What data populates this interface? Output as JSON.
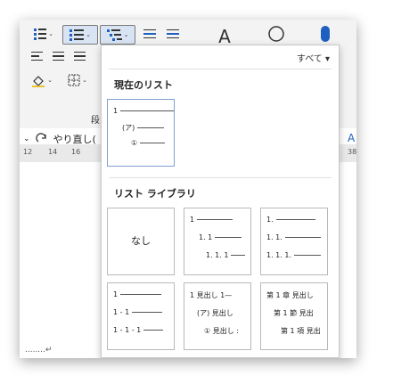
{
  "ribbon": {
    "paragraph_group_label": "段",
    "undo_label": "やり直し(",
    "font_style_icon": "A"
  },
  "ruler": {
    "ticks": [
      "12",
      "14",
      "16",
      "38"
    ]
  },
  "dropdown": {
    "filter_label": "すべて ▾",
    "current_list_title": "現在のリスト",
    "library_title": "リスト ライブラリ",
    "current_list": [
      {
        "label": "1",
        "indent": 0,
        "line": 60
      },
      {
        "label": "(ア)",
        "indent": 10,
        "line": 30
      },
      {
        "label": "①",
        "indent": 20,
        "line": 28
      }
    ],
    "library": [
      {
        "type": "none",
        "label": "なし"
      },
      {
        "type": "rows",
        "rows": [
          {
            "label": "1",
            "indent": 0,
            "line": 40
          },
          {
            "label": "1. 1",
            "indent": 10,
            "line": 30
          },
          {
            "label": "1. 1. 1",
            "indent": 18,
            "line": 16
          }
        ]
      },
      {
        "type": "rows",
        "rows": [
          {
            "label": "1.",
            "indent": 0,
            "line": 44
          },
          {
            "label": "1. 1.",
            "indent": 0,
            "line": 40
          },
          {
            "label": "1. 1. 1.",
            "indent": 0,
            "line": 30
          }
        ]
      },
      {
        "type": "rows",
        "rows": [
          {
            "label": "1",
            "indent": 0,
            "line": 46
          },
          {
            "label": "1 - 1",
            "indent": 0,
            "line": 34
          },
          {
            "label": "1 - 1 - 1",
            "indent": 0,
            "line": 22
          }
        ]
      },
      {
        "type": "rows",
        "rows": [
          {
            "label": "1 見出し 1—",
            "indent": 0,
            "line": 0
          },
          {
            "label": "(ア) 見出し",
            "indent": 8,
            "line": 0
          },
          {
            "label": "① 見出し :",
            "indent": 16,
            "line": 0
          }
        ]
      },
      {
        "type": "rows",
        "rows": [
          {
            "label": "第 1 章 見出し",
            "indent": 0,
            "line": 0
          },
          {
            "label": "第 1 節 見出",
            "indent": 8,
            "line": 0
          },
          {
            "label": "第 1 項 見出",
            "indent": 16,
            "line": 0
          }
        ]
      }
    ]
  }
}
